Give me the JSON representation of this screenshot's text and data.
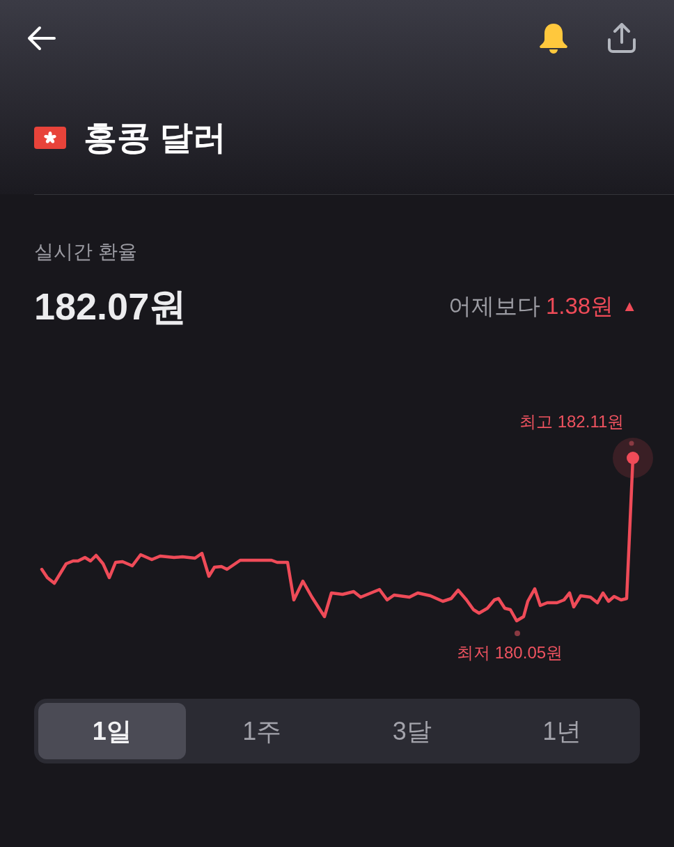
{
  "header": {
    "alert_on": true
  },
  "currency": {
    "title": "홍콩 달러"
  },
  "rate": {
    "label": "실시간 환율",
    "value": "182.07원",
    "change_prefix": "어제보다",
    "change": "1.38원",
    "rising": true,
    "direction_icon": "▲"
  },
  "chart": {
    "high_label": "최고 182.11원",
    "low_label": "최저 180.05원"
  },
  "periods": [
    {
      "label": "1일",
      "selected": true
    },
    {
      "label": "1주",
      "selected": false
    },
    {
      "label": "3달",
      "selected": false
    },
    {
      "label": "1년",
      "selected": false
    }
  ]
}
